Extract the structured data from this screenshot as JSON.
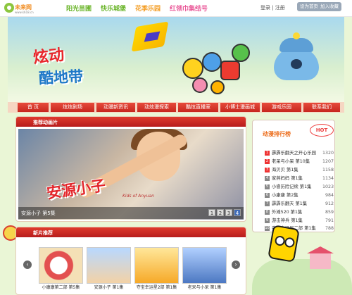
{
  "topbar": {
    "logo_name": "未来网",
    "logo_sub": "www.k618.cn",
    "links": [
      "阳光苗圃",
      "快乐城堡",
      "花季乐园",
      "红领巾集结号"
    ],
    "login": "登录 | 注册",
    "home_btn": "设为首页",
    "fav_btn": "加入收藏"
  },
  "banner": {
    "title1": "炫动",
    "title2": "酷地带"
  },
  "nav": [
    "首 页",
    "炫炫剧场",
    "动漫新资讯",
    "动炫漫探索",
    "酷炫直播室",
    "小博士漫画城",
    "游戏乐园",
    "联系我们"
  ],
  "featured": {
    "title": "推荐动画片",
    "art_title": "安源小子",
    "art_en": "Kids of Anyuan",
    "caption": "安源小子 第5集",
    "pages": [
      "1",
      "2",
      "3",
      "4"
    ]
  },
  "newfilms": {
    "title": "新片推荐",
    "items": [
      {
        "caption": "小康康第二部 第5集"
      },
      {
        "caption": "安源小子 第1集"
      },
      {
        "caption": "夺宝幸运星2部 第1集"
      },
      {
        "caption": "老呆与小呆 第1集"
      }
    ],
    "prev": "‹",
    "next": "›"
  },
  "ranking": {
    "title": "动漫排行榜",
    "hot": "HOT",
    "rows": [
      {
        "num": "1",
        "name": "霹霹乐翻天之开心乐园",
        "value": "1320"
      },
      {
        "num": "2",
        "name": "老呆与小呆 第10集",
        "value": "1207"
      },
      {
        "num": "3",
        "name": "海贝贝 第1集",
        "value": "1158"
      },
      {
        "num": "4",
        "name": "家燕妈妈 第1集",
        "value": "1134"
      },
      {
        "num": "5",
        "name": "小睿历险记续 第1集",
        "value": "1023"
      },
      {
        "num": "6",
        "name": "小康康 第2集",
        "value": "984"
      },
      {
        "num": "7",
        "name": "霹霹乐翻天 第1集",
        "value": "912"
      },
      {
        "num": "8",
        "name": "外滩520 第1集",
        "value": "859"
      },
      {
        "num": "9",
        "name": "游击神兵 第1集",
        "value": "791"
      },
      {
        "num": "10",
        "name": "夺宝幸运星二部 第1集",
        "value": "788"
      }
    ]
  },
  "colors": {
    "accent": "#d32f2f",
    "orange": "#f39a1d",
    "green": "#6bb52b"
  }
}
